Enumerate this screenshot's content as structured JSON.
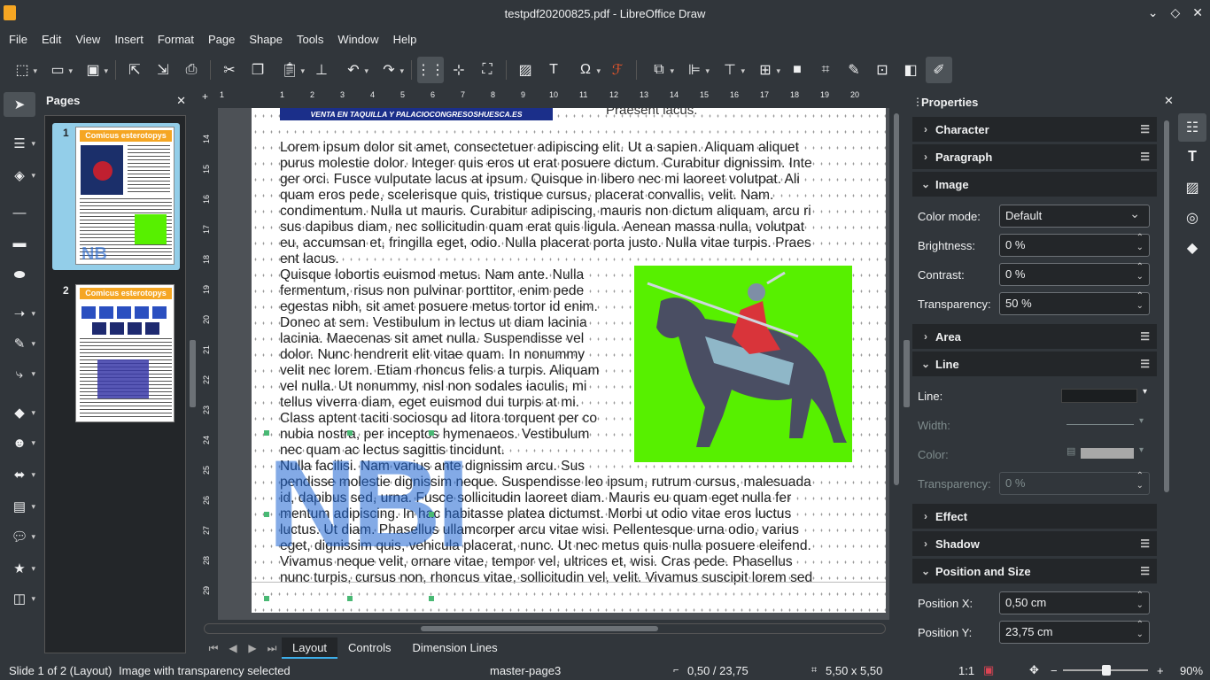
{
  "window": {
    "title": "testpdf20200825.pdf - LibreOffice Draw"
  },
  "menu": [
    "File",
    "Edit",
    "View",
    "Insert",
    "Format",
    "Page",
    "Shape",
    "Tools",
    "Window",
    "Help"
  ],
  "pages_panel": {
    "title": "Pages",
    "pages": [
      {
        "number": "1",
        "header": "Comicus esterotopys"
      },
      {
        "number": "2",
        "header": "Comicus esterotopys"
      }
    ]
  },
  "ruler": {
    "h_ticks": [
      "1",
      "1",
      "2",
      "3",
      "4",
      "5",
      "6",
      "7",
      "8",
      "9",
      "10",
      "11",
      "12",
      "13",
      "14",
      "15",
      "16",
      "17",
      "18",
      "19",
      "20",
      "21"
    ],
    "v_ticks": [
      "14",
      "15",
      "16",
      "17",
      "18",
      "19",
      "20",
      "21",
      "22",
      "23",
      "24",
      "25",
      "26",
      "27",
      "28",
      "29"
    ]
  },
  "document": {
    "banner": "VENTA EN TAQUILLA Y PALACIOCONGRESOSHUESCA.ES",
    "ghost_text": "Praesent lacus.",
    "lines": [
      "Lorem ipsum dolor sit amet, consectetuer adipiscing elit. Ut a sapien. Aliquam aliquet",
      "purus molestie dolor. Integer quis eros ut erat posuere dictum. Curabitur dignissim. Inte",
      "ger orci. Fusce vulputate lacus at ipsum. Quisque in libero nec mi laoreet volutpat. Ali",
      "quam  eros  pede,  scelerisque  quis,  tristique  cursus,  placerat  convallis,  velit.  Nam.",
      "condimentum. Nulla ut mauris. Curabitur adipiscing, mauris non dictum aliquam, arcu ri",
      "sus dapibus diam, nec sollicitudin quam erat quis ligula. Aenean massa nulla, volutpat",
      "eu, accumsan et, fringilla eget, odio. Nulla placerat porta justo. Nulla vitae turpis. Praes",
      "ent lacus.",
      "Quisque  lobortis  euismod  metus.  Nam  ante.  Nulla",
      "fermentum,  risus  non  pulvinar  porttitor,  enim  pede",
      "egestas nibh, sit amet posuere metus tortor id enim.",
      "Donec at sem. Vestibulum in lectus ut diam lacinia",
      "lacinia.  Maecenas  sit  amet  nulla.  Suspendisse  vel",
      "dolor.  Nunc  hendrerit  elit  vitae  quam.  In  nonummy",
      "velit nec lorem. Etiam rhoncus felis a turpis. Aliquam",
      "vel nulla. Ut nonummy, nisl non sodales iaculis, mi",
      "tellus  viverra  diam,  eget  euismod  dui  turpis  at  mi.",
      "Class aptent taciti sociosqu ad litora torquent per co",
      "nubia  nostra,  per  inceptos  hymenaeos.  Vestibulum",
      "nec quam ac lectus sagittis tincidunt.",
      "Nulla facilisi. Nam varius ante dignissim arcu. Sus",
      "pendisse molestie dignissim neque. Suspendisse leo ipsum, rutrum cursus, malesuada",
      "id, dapibus sed, urna. Fusce sollicitudin laoreet diam. Mauris eu quam eget nulla fer",
      "mentum  adipiscing.  In  hac  habitasse  platea  dictumst.  Morbi  ut  odio  vitae  eros  luctus",
      "luctus. Ut diam. Phasellus ullamcorper arcu vitae wisi. Pellentesque urna odio, varius",
      "eget, dignissim quis, vehicula placerat, nunc. Ut nec metus quis nulla posuere eleifend.",
      "Vivamus  neque  velit,  ornare  vitae,  tempor  vel,  ultrices  et,  wisi.  Cras  pede.  Phasellus",
      "nunc turpis, cursus non, rhoncus vitae, sollicitudin vel, velit. Vivamus suscipit lorem sed"
    ],
    "logo_text": "NBI"
  },
  "tabs": [
    "Layout",
    "Controls",
    "Dimension Lines"
  ],
  "status": {
    "slide": "Slide 1 of 2 (Layout)",
    "selection": "Image with transparency selected",
    "master": "master-page3",
    "position": "0,50 / 23,75",
    "size": "5,50 x 5,50",
    "scale": "1:1",
    "zoom": "90%"
  },
  "properties": {
    "title": "Properties",
    "sections": {
      "character": "Character",
      "paragraph": "Paragraph",
      "image": "Image",
      "area": "Area",
      "line": "Line",
      "effect": "Effect",
      "shadow": "Shadow",
      "position_size": "Position and Size"
    },
    "image": {
      "color_mode_label": "Color mode:",
      "color_mode": "Default",
      "brightness_label": "Brightness:",
      "brightness": "0 %",
      "contrast_label": "Contrast:",
      "contrast": "0 %",
      "transparency_label": "Transparency:",
      "transparency": "50 %"
    },
    "line": {
      "line_label": "Line:",
      "width_label": "Width:",
      "color_label": "Color:",
      "transparency_label": "Transparency:",
      "transparency": "0 %"
    },
    "position": {
      "x_label": "Position X:",
      "x": "0,50 cm",
      "y_label": "Position Y:",
      "y": "23,75 cm"
    }
  },
  "colors": {
    "accent": "#3daee9",
    "image_bg": "#57f000",
    "thumb_header": "#f5a623"
  }
}
